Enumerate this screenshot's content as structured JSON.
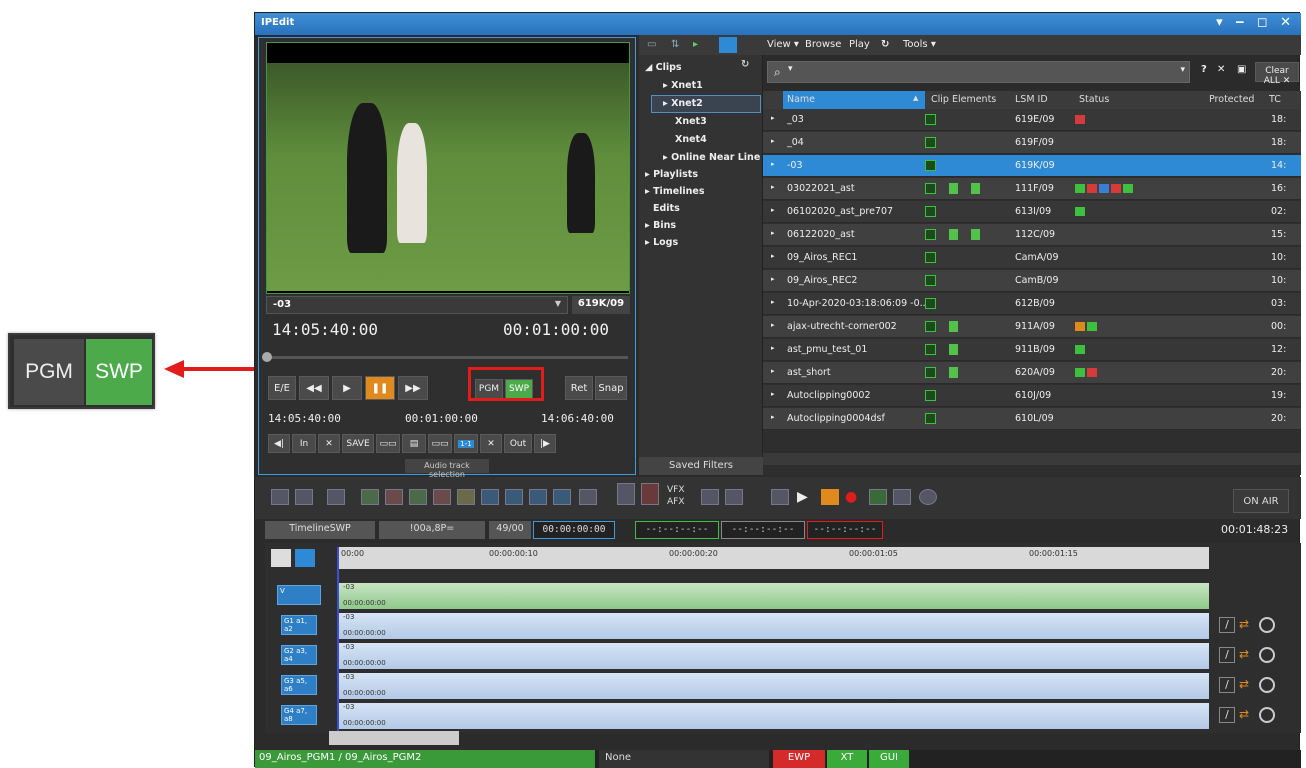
{
  "callout": {
    "pgm": "PGM",
    "swp": "SWP"
  },
  "window": {
    "title": "IPEdit",
    "controls": "▾ ‒ ◻ ✕"
  },
  "player": {
    "clip_name": "-03",
    "clip_id": "619K/09",
    "tc_current": "14:05:40:00",
    "tc_duration": "00:01:00:00",
    "transport": {
      "ee": "E/E",
      "rew": "◀◀",
      "play": "▶",
      "pause": "❚❚",
      "ff": "▶▶",
      "pgm": "PGM",
      "swp": "SWP",
      "ret": "Ret",
      "snap": "Snap"
    },
    "tc_in": "14:05:40:00",
    "tc_dur2": "00:01:00:00",
    "tc_out": "14:06:40:00",
    "edit_buttons": {
      "to_start": "◀|",
      "in": "In",
      "clear_in": "✕",
      "save": "SAVE",
      "clear_out": "✕",
      "out": "Out",
      "to_end": "|▶"
    },
    "audio_track_selection": "Audio track selection"
  },
  "tree": {
    "items": [
      "Clips",
      "Xnet1",
      "Xnet2",
      "Xnet3",
      "Xnet4",
      "Online Near Line",
      "Playlists",
      "Timelines",
      "Edits",
      "Bins",
      "Logs"
    ],
    "saved_filters": "Saved Filters"
  },
  "menubar": {
    "view": "View ▾",
    "browse": "Browse",
    "play": "Play",
    "tools": "Tools ▾"
  },
  "search": {
    "placeholder": "",
    "help": "?",
    "clear": "✕",
    "clear_all": "Clear ALL ✕"
  },
  "grid": {
    "columns": [
      "Name",
      "Clip Elements",
      "LSM ID",
      "Status",
      "Protected",
      "TC"
    ],
    "rows": [
      {
        "name": "_03",
        "lsm": "619E/09",
        "tc": "18:"
      },
      {
        "name": "_04",
        "lsm": "619F/09",
        "tc": "18:"
      },
      {
        "name": "-03",
        "lsm": "619K/09",
        "tc": "14:"
      },
      {
        "name": "03022021_ast",
        "lsm": "111F/09",
        "tc": "16:"
      },
      {
        "name": "06102020_ast_pre707",
        "lsm": "613I/09",
        "tc": "02:"
      },
      {
        "name": "06122020_ast",
        "lsm": "112C/09",
        "tc": "15:"
      },
      {
        "name": "09_Airos_REC1",
        "lsm": "CamA/09",
        "tc": "10:"
      },
      {
        "name": "09_Airos_REC2",
        "lsm": "CamB/09",
        "tc": "10:"
      },
      {
        "name": "10-Apr-2020-03:18:06:09 -0...",
        "lsm": "612B/09",
        "tc": "03:"
      },
      {
        "name": "ajax-utrecht-corner002",
        "lsm": "911A/09",
        "tc": "00:"
      },
      {
        "name": "ast_pmu_test_01",
        "lsm": "911B/09",
        "tc": "12:"
      },
      {
        "name": "ast_short",
        "lsm": "620A/09",
        "tc": "20:"
      },
      {
        "name": "Autoclipping0002",
        "lsm": "610J/09",
        "tc": "19:"
      },
      {
        "name": "Autoclipping0004dsf",
        "lsm": "610L/09",
        "tc": "20:"
      }
    ]
  },
  "bottom": {
    "vfx": "VFX",
    "afx": "AFX",
    "on_air": "ON AIR",
    "timeline_name": "TimelineSWP",
    "field2": "!00a,8P=",
    "field3": "49/00",
    "tc_field": "00:00:00:00",
    "tc_green": "--:--:--:--",
    "tc_gray": "--:--:--:--",
    "tc_red": "--:--:--:--",
    "total": "00:01:48:23"
  },
  "timeline": {
    "ruler": [
      "00:00",
      "00:00:00:10",
      "00:00:00:20",
      "00:00:01:05",
      "00:00:01:15"
    ],
    "tracks": [
      {
        "label": "V",
        "clip": "-03",
        "tc": "00:00:00:00"
      },
      {
        "label": "G1 a1, a2",
        "clip": "-03",
        "tc": "00:00:00:00"
      },
      {
        "label": "G2 a3, a4",
        "clip": "-03",
        "tc": "00:00:00:00"
      },
      {
        "label": "G3 a5, a6",
        "clip": "-03",
        "tc": "00:00:00:00"
      },
      {
        "label": "G4 a7, a8",
        "clip": "-03",
        "tc": "00:00:00:00"
      }
    ]
  },
  "statusbar": {
    "source": "09_Airos_PGM1 / 09_Airos_PGM2",
    "mid": "None",
    "ewp": "EWP",
    "xt": "XT",
    "gui": "GUI"
  },
  "colors": {
    "accent_blue": "#2f8ad6",
    "green": "#4caa4a",
    "red": "#e21b1b"
  }
}
